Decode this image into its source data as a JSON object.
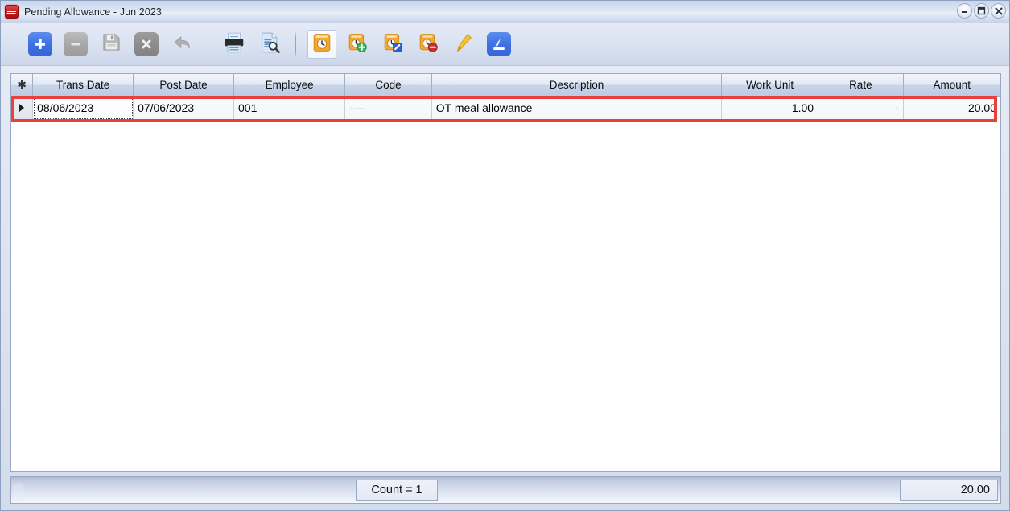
{
  "window": {
    "title": "Pending Allowance - Jun 2023",
    "app_icon": "payroll-app-icon",
    "controls": {
      "minimize": "minimize-button",
      "maximize": "maximize-button",
      "close": "close-button"
    }
  },
  "toolbar": {
    "buttons": [
      {
        "name": "add-record-button",
        "icon": "plus-icon",
        "tooltip": "Add",
        "state": "enabled"
      },
      {
        "name": "delete-record-button",
        "icon": "minus-icon",
        "tooltip": "Delete",
        "state": "disabled"
      },
      {
        "name": "save-record-button",
        "icon": "floppy-disk-icon",
        "tooltip": "Save",
        "state": "disabled"
      },
      {
        "name": "cancel-record-button",
        "icon": "x-icon",
        "tooltip": "Cancel",
        "state": "disabled"
      },
      {
        "name": "undo-button",
        "icon": "undo-arrow-icon",
        "tooltip": "Undo",
        "state": "disabled"
      },
      {
        "name": "print-button",
        "icon": "printer-icon",
        "tooltip": "Print",
        "state": "enabled"
      },
      {
        "name": "print-preview-button",
        "icon": "document-magnifier-icon",
        "tooltip": "Print Preview",
        "state": "enabled"
      },
      {
        "name": "pending-allowance-button",
        "icon": "clock-folder-icon",
        "tooltip": "Pending Allowance",
        "state": "selected"
      },
      {
        "name": "add-allowance-button",
        "icon": "clock-folder-plus-icon",
        "tooltip": "Add Allowance",
        "state": "enabled"
      },
      {
        "name": "edit-allowance-button",
        "icon": "clock-folder-edit-icon",
        "tooltip": "Edit Allowance",
        "state": "enabled"
      },
      {
        "name": "remove-allowance-button",
        "icon": "clock-folder-minus-icon",
        "tooltip": "Remove Allowance",
        "state": "enabled"
      },
      {
        "name": "highlighter-button",
        "icon": "highlighter-pen-icon",
        "tooltip": "Highlight",
        "state": "enabled"
      },
      {
        "name": "export-button",
        "icon": "export-download-icon",
        "tooltip": "Export",
        "state": "enabled"
      }
    ]
  },
  "grid": {
    "row_indicator_header": "✱",
    "columns": [
      {
        "key": "trans_date",
        "label": "Trans Date",
        "align": "left"
      },
      {
        "key": "post_date",
        "label": "Post Date",
        "align": "left"
      },
      {
        "key": "employee",
        "label": "Employee",
        "align": "left"
      },
      {
        "key": "code",
        "label": "Code",
        "align": "left"
      },
      {
        "key": "description",
        "label": "Description",
        "align": "left"
      },
      {
        "key": "work_unit",
        "label": "Work Unit",
        "align": "right"
      },
      {
        "key": "rate",
        "label": "Rate",
        "align": "right"
      },
      {
        "key": "amount",
        "label": "Amount",
        "align": "right"
      }
    ],
    "rows": [
      {
        "selected": true,
        "indicator": "▶",
        "trans_date": "08/06/2023",
        "post_date": "07/06/2023",
        "employee": "001",
        "code": "----",
        "description": "OT meal allowance",
        "work_unit": "1.00",
        "rate": "-",
        "amount": "20.00"
      }
    ]
  },
  "annotation": {
    "color": "#e8413c",
    "target": "selected-row-highlight"
  },
  "statusbar": {
    "count_label": "Count = 1",
    "total_amount": "20.00"
  }
}
